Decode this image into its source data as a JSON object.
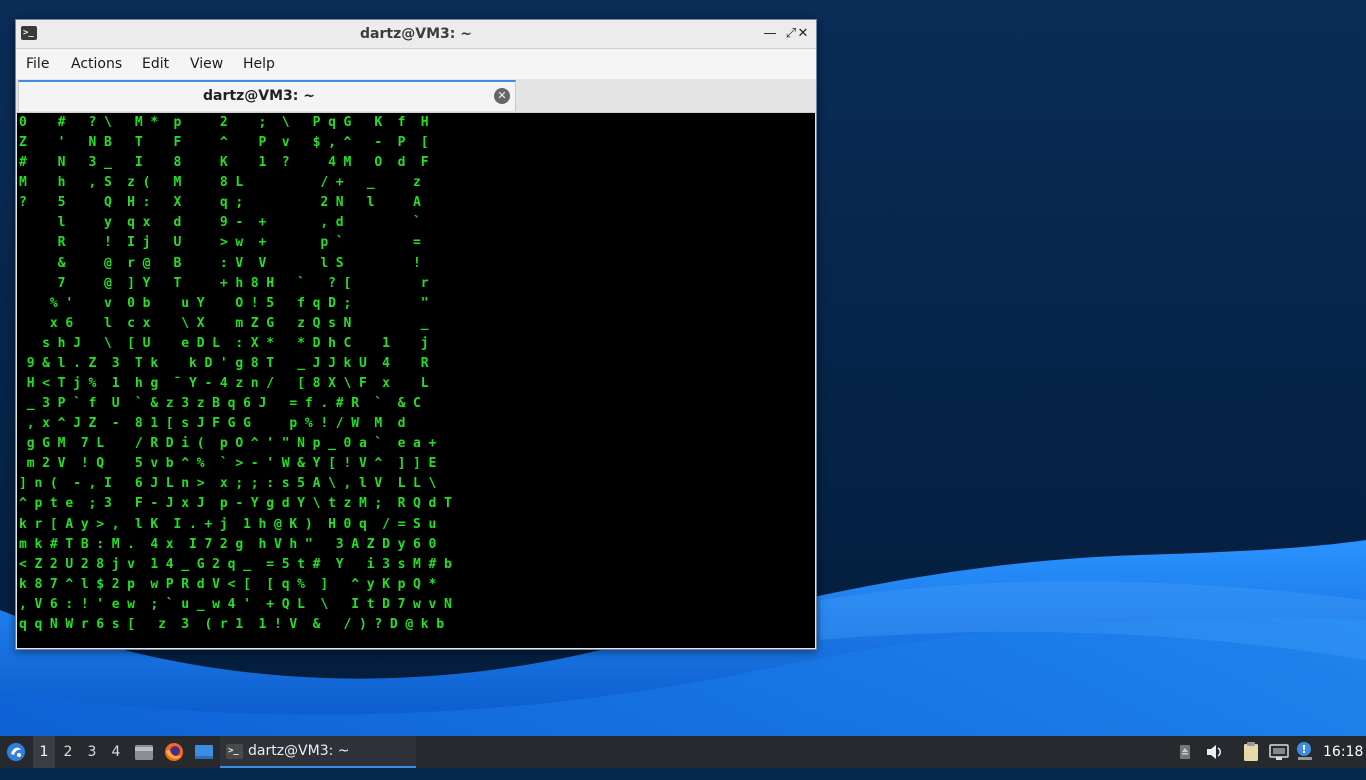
{
  "window": {
    "title": "dartz@VM3: ~",
    "minimize_glyph": "—",
    "maximize_glyph": "⤢",
    "close_glyph": "✕",
    "app_icon": "terminal-icon"
  },
  "menu": {
    "file": "File",
    "actions": "Actions",
    "edit": "Edit",
    "view": "View",
    "help": "Help"
  },
  "tab": {
    "label": "dartz@VM3: ~",
    "close_glyph": "✕"
  },
  "terminal": {
    "text": "0    #   ? \\   M *  p     2    ;  \\   P q G   K  f  H\nZ    '   N B   T    F     ^    P  v   $ , ^   -  P  [\n#    N   3 _   I    8     K    1  ?     4 M   O  d  F\nM    h   , S  z (   M     8 L          / +   _     z\n?    5     Q  H :   X     q ;          2 N   l     A\n     l     y  q x   d     9 -  +       , d         `\n     R     !  I j   U     > w  +       p `         =\n     &     @  r @   B     : V  V       l S         !\n     7     @  ] Y   T     + h 8 H   `   ? [         r\n    % '    v  0 b    u Y    O ! 5   f q D ;         \"\n    x 6    l  c x    \\ X    m Z G   z Q s N         _\n   s h J   \\  [ U    e D L  : X *   * D h C    1    j\n 9 & l . Z  3  T k    k D ' g 8 T   _ J J k U  4    R\n H < T j %  1  h g  ¯ Y - 4 z n /   [ 8 X \\ F  x    L\n _ 3 P ` f  U  ` & z 3 z B q 6 J   = f . # R  `  & C\n , x ^ J Z  -  8 1 [ s J F G G     p % ! / W  M  d\n g G M  7 L    / R D i (  p O ^ ' \" N p _ 0 a `  e a +\n m 2 V  ! Q    5 v b ^ %  ` > - ' W & Y [ ! V ^  ] ] E\n] n (  - , I   6 J L n >  x ; ; : s 5 A \\ , l V  L L \\\n^ p t e  ; 3   F - J x J  p - Y g d Y \\ t z M ;  R Q d T\nk r [ A y > ,  l K  I . + j  1 h @ K )  H 0 q  / = S u\nm k # T B : M .  4 x  I 7 2 g  h V h \"   3 A Z D y 6 0\n< Z 2 U 2 8 j v  1 4 _ G 2 q _  = 5 t #  Y   i 3 s M # b\nk 8 7 ^ l $ 2 p  w P R d V < [  [ q %  ]   ^ y K p Q *\n, V 6 : ! ' e w  ; ` u _ w 4 '  + Q L  \\   I t D 7 w v N\nq q N W r 6 s [   z  3  ( r 1  1 ! V  &   / ) ? D @ k b"
  },
  "taskbar": {
    "start_icon": "start-menu-icon",
    "workspaces": [
      "1",
      "2",
      "3",
      "4"
    ],
    "quicklaunch": [
      "file-manager-icon",
      "firefox-icon",
      "desktop-icon"
    ],
    "task_label": "dartz@VM3: ~",
    "tray": [
      "eject-icon",
      "volume-icon",
      "clipboard-icon",
      "network-icon",
      "update-notifier-icon"
    ],
    "clock": "16:18"
  },
  "colors": {
    "terminal_fg": "#22e022",
    "terminal_bg": "#000000",
    "desktop_dark": "#05264d",
    "desktop_wave": "#1e7fe6",
    "taskbar_bg": "#26292e",
    "accent": "#3d8ee0"
  }
}
